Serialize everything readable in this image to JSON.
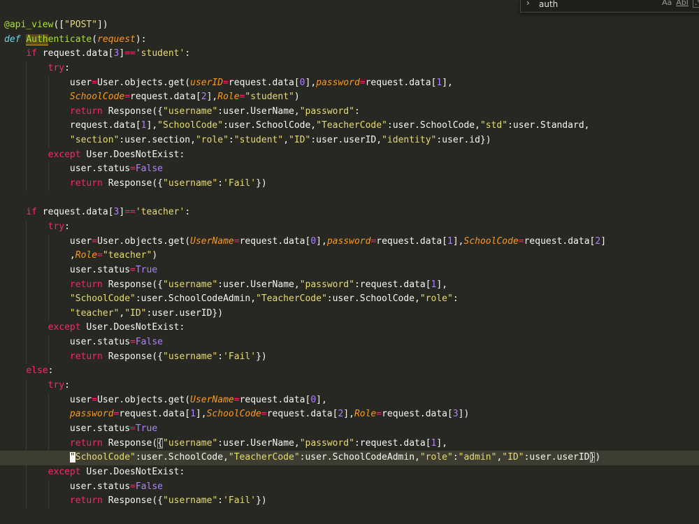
{
  "find_widget": {
    "query": "auth",
    "match_case_label": "Aa",
    "whole_word_label": "Abl",
    "regex_label": ".*",
    "toggle_icon": "chevron-right-icon"
  },
  "colors": {
    "background": "#272822",
    "keyword": "#f92672",
    "function": "#a6e22e",
    "string": "#e6db74",
    "number": "#ae81ff",
    "parameter": "#fd971f",
    "storage": "#66d9ef"
  },
  "code": {
    "lines": [
      {
        "indent": 0,
        "tokens": [
          {
            "t": "deco",
            "v": "@api_view"
          },
          {
            "t": "plain",
            "v": "(["
          },
          {
            "t": "str",
            "v": "\"POST\""
          },
          {
            "t": "plain",
            "v": "])"
          }
        ]
      },
      {
        "indent": 0,
        "tokens": [
          {
            "t": "def",
            "v": "def "
          },
          {
            "t": "fn-hl",
            "v": "Auth"
          },
          {
            "t": "fn",
            "v": "enticate"
          },
          {
            "t": "plain",
            "v": "("
          },
          {
            "t": "param",
            "v": "request"
          },
          {
            "t": "plain",
            "v": "):"
          }
        ]
      },
      {
        "indent": 1,
        "tokens": [
          {
            "t": "kw",
            "v": "if "
          },
          {
            "t": "plain",
            "v": "request.data["
          },
          {
            "t": "num",
            "v": "3"
          },
          {
            "t": "plain",
            "v": "]"
          },
          {
            "t": "op",
            "v": "=="
          },
          {
            "t": "str",
            "v": "'student'"
          },
          {
            "t": "plain",
            "v": ":"
          }
        ]
      },
      {
        "indent": 2,
        "tokens": [
          {
            "t": "kw",
            "v": "try"
          },
          {
            "t": "plain",
            "v": ":"
          }
        ]
      },
      {
        "indent": 3,
        "tokens": [
          {
            "t": "plain",
            "v": "user"
          },
          {
            "t": "op",
            "v": "="
          },
          {
            "t": "plain",
            "v": "User.objects.get("
          },
          {
            "t": "param",
            "v": "userID"
          },
          {
            "t": "op",
            "v": "="
          },
          {
            "t": "plain",
            "v": "request.data["
          },
          {
            "t": "num",
            "v": "0"
          },
          {
            "t": "plain",
            "v": "],"
          },
          {
            "t": "param",
            "v": "password"
          },
          {
            "t": "op",
            "v": "="
          },
          {
            "t": "plain",
            "v": "request.data["
          },
          {
            "t": "num",
            "v": "1"
          },
          {
            "t": "plain",
            "v": "],"
          }
        ]
      },
      {
        "indent": 3,
        "tokens": [
          {
            "t": "param",
            "v": "SchoolCode"
          },
          {
            "t": "op",
            "v": "="
          },
          {
            "t": "plain",
            "v": "request.data["
          },
          {
            "t": "num",
            "v": "2"
          },
          {
            "t": "plain",
            "v": "],"
          },
          {
            "t": "param",
            "v": "Role"
          },
          {
            "t": "op",
            "v": "="
          },
          {
            "t": "str",
            "v": "\"student\""
          },
          {
            "t": "plain",
            "v": ")"
          }
        ]
      },
      {
        "indent": 3,
        "tokens": [
          {
            "t": "kw",
            "v": "return "
          },
          {
            "t": "plain",
            "v": "Response({"
          },
          {
            "t": "str",
            "v": "\"username\""
          },
          {
            "t": "plain",
            "v": ":user.UserName,"
          },
          {
            "t": "str",
            "v": "\"password\""
          },
          {
            "t": "plain",
            "v": ":"
          }
        ]
      },
      {
        "indent": 3,
        "tokens": [
          {
            "t": "plain",
            "v": "request.data["
          },
          {
            "t": "num",
            "v": "1"
          },
          {
            "t": "plain",
            "v": "],"
          },
          {
            "t": "str",
            "v": "\"SchoolCode\""
          },
          {
            "t": "plain",
            "v": ":user.SchoolCode,"
          },
          {
            "t": "str",
            "v": "\"TeacherCode\""
          },
          {
            "t": "plain",
            "v": ":user.SchoolCode,"
          },
          {
            "t": "str",
            "v": "\"std\""
          },
          {
            "t": "plain",
            "v": ":user.Standard,"
          }
        ]
      },
      {
        "indent": 3,
        "tokens": [
          {
            "t": "str",
            "v": "\"section\""
          },
          {
            "t": "plain",
            "v": ":user.section,"
          },
          {
            "t": "str",
            "v": "\"role\""
          },
          {
            "t": "plain",
            "v": ":"
          },
          {
            "t": "str",
            "v": "\"student\""
          },
          {
            "t": "plain",
            "v": ","
          },
          {
            "t": "str",
            "v": "\"ID\""
          },
          {
            "t": "plain",
            "v": ":user.userID,"
          },
          {
            "t": "str",
            "v": "\"identity\""
          },
          {
            "t": "plain",
            "v": ":user.id})"
          }
        ]
      },
      {
        "indent": 2,
        "tokens": [
          {
            "t": "kw",
            "v": "except "
          },
          {
            "t": "plain",
            "v": "User.DoesNotExist:"
          }
        ]
      },
      {
        "indent": 3,
        "tokens": [
          {
            "t": "plain",
            "v": "user.status"
          },
          {
            "t": "op",
            "v": "="
          },
          {
            "t": "const",
            "v": "False"
          }
        ]
      },
      {
        "indent": 3,
        "tokens": [
          {
            "t": "kw",
            "v": "return "
          },
          {
            "t": "plain",
            "v": "Response({"
          },
          {
            "t": "str",
            "v": "\"username\""
          },
          {
            "t": "plain",
            "v": ":"
          },
          {
            "t": "str",
            "v": "'Fail'"
          },
          {
            "t": "plain",
            "v": "})"
          }
        ]
      },
      {
        "indent": 0,
        "tokens": []
      },
      {
        "indent": 1,
        "tokens": [
          {
            "t": "kw",
            "v": "if "
          },
          {
            "t": "plain",
            "v": "request.data["
          },
          {
            "t": "num",
            "v": "3"
          },
          {
            "t": "plain",
            "v": "]"
          },
          {
            "t": "op",
            "v": "=="
          },
          {
            "t": "str",
            "v": "'teacher'"
          },
          {
            "t": "plain",
            "v": ":"
          }
        ]
      },
      {
        "indent": 2,
        "tokens": [
          {
            "t": "kw",
            "v": "try"
          },
          {
            "t": "plain",
            "v": ":"
          }
        ]
      },
      {
        "indent": 3,
        "tokens": [
          {
            "t": "plain",
            "v": "user"
          },
          {
            "t": "op",
            "v": "="
          },
          {
            "t": "plain",
            "v": "User.objects.get("
          },
          {
            "t": "param",
            "v": "UserName"
          },
          {
            "t": "op",
            "v": "="
          },
          {
            "t": "plain",
            "v": "request.data["
          },
          {
            "t": "num",
            "v": "0"
          },
          {
            "t": "plain",
            "v": "],"
          },
          {
            "t": "param",
            "v": "password"
          },
          {
            "t": "op",
            "v": "="
          },
          {
            "t": "plain",
            "v": "request.data["
          },
          {
            "t": "num",
            "v": "1"
          },
          {
            "t": "plain",
            "v": "],"
          },
          {
            "t": "param",
            "v": "SchoolCode"
          },
          {
            "t": "op",
            "v": "="
          },
          {
            "t": "plain",
            "v": "request.data["
          },
          {
            "t": "num",
            "v": "2"
          },
          {
            "t": "plain",
            "v": "]"
          }
        ]
      },
      {
        "indent": 3,
        "tokens": [
          {
            "t": "plain",
            "v": ","
          },
          {
            "t": "param",
            "v": "Role"
          },
          {
            "t": "op",
            "v": "="
          },
          {
            "t": "str",
            "v": "\"teacher\""
          },
          {
            "t": "plain",
            "v": ")"
          }
        ]
      },
      {
        "indent": 3,
        "tokens": [
          {
            "t": "plain",
            "v": "user.status"
          },
          {
            "t": "op",
            "v": "="
          },
          {
            "t": "const",
            "v": "True"
          }
        ]
      },
      {
        "indent": 3,
        "tokens": [
          {
            "t": "kw",
            "v": "return "
          },
          {
            "t": "plain",
            "v": "Response({"
          },
          {
            "t": "str",
            "v": "\"username\""
          },
          {
            "t": "plain",
            "v": ":user.UserName,"
          },
          {
            "t": "str",
            "v": "\"password\""
          },
          {
            "t": "plain",
            "v": ":request.data["
          },
          {
            "t": "num",
            "v": "1"
          },
          {
            "t": "plain",
            "v": "],"
          }
        ]
      },
      {
        "indent": 3,
        "tokens": [
          {
            "t": "str",
            "v": "\"SchoolCode\""
          },
          {
            "t": "plain",
            "v": ":user.SchoolCodeAdmin,"
          },
          {
            "t": "str",
            "v": "\"TeacherCode\""
          },
          {
            "t": "plain",
            "v": ":user.SchoolCode,"
          },
          {
            "t": "str",
            "v": "\"role\""
          },
          {
            "t": "plain",
            "v": ":"
          }
        ]
      },
      {
        "indent": 3,
        "tokens": [
          {
            "t": "str",
            "v": "\"teacher\""
          },
          {
            "t": "plain",
            "v": ","
          },
          {
            "t": "str",
            "v": "\"ID\""
          },
          {
            "t": "plain",
            "v": ":user.userID})"
          }
        ]
      },
      {
        "indent": 2,
        "tokens": [
          {
            "t": "kw",
            "v": "except "
          },
          {
            "t": "plain",
            "v": "User.DoesNotExist:"
          }
        ]
      },
      {
        "indent": 3,
        "tokens": [
          {
            "t": "plain",
            "v": "user.status"
          },
          {
            "t": "op",
            "v": "="
          },
          {
            "t": "const",
            "v": "False"
          }
        ]
      },
      {
        "indent": 3,
        "tokens": [
          {
            "t": "kw",
            "v": "return "
          },
          {
            "t": "plain",
            "v": "Response({"
          },
          {
            "t": "str",
            "v": "\"username\""
          },
          {
            "t": "plain",
            "v": ":"
          },
          {
            "t": "str",
            "v": "'Fail'"
          },
          {
            "t": "plain",
            "v": "})"
          }
        ]
      },
      {
        "indent": 1,
        "tokens": [
          {
            "t": "kw",
            "v": "else"
          },
          {
            "t": "plain",
            "v": ":"
          }
        ]
      },
      {
        "indent": 2,
        "tokens": [
          {
            "t": "kw",
            "v": "try"
          },
          {
            "t": "plain",
            "v": ":"
          }
        ]
      },
      {
        "indent": 3,
        "tokens": [
          {
            "t": "plain",
            "v": "user"
          },
          {
            "t": "op",
            "v": "="
          },
          {
            "t": "plain",
            "v": "User.objects.get("
          },
          {
            "t": "param",
            "v": "UserName"
          },
          {
            "t": "op",
            "v": "="
          },
          {
            "t": "plain",
            "v": "request.data["
          },
          {
            "t": "num",
            "v": "0"
          },
          {
            "t": "plain",
            "v": "],"
          }
        ]
      },
      {
        "indent": 3,
        "tokens": [
          {
            "t": "param",
            "v": "password"
          },
          {
            "t": "op",
            "v": "="
          },
          {
            "t": "plain",
            "v": "request.data["
          },
          {
            "t": "num",
            "v": "1"
          },
          {
            "t": "plain",
            "v": "],"
          },
          {
            "t": "param",
            "v": "SchoolCode"
          },
          {
            "t": "op",
            "v": "="
          },
          {
            "t": "plain",
            "v": "request.data["
          },
          {
            "t": "num",
            "v": "2"
          },
          {
            "t": "plain",
            "v": "],"
          },
          {
            "t": "param",
            "v": "Role"
          },
          {
            "t": "op",
            "v": "="
          },
          {
            "t": "plain",
            "v": "request.data["
          },
          {
            "t": "num",
            "v": "3"
          },
          {
            "t": "plain",
            "v": "])"
          }
        ]
      },
      {
        "indent": 3,
        "tokens": [
          {
            "t": "plain",
            "v": "user.status"
          },
          {
            "t": "op",
            "v": "="
          },
          {
            "t": "const",
            "v": "True"
          }
        ]
      },
      {
        "indent": 3,
        "tokens": [
          {
            "t": "kw",
            "v": "return "
          },
          {
            "t": "plain",
            "v": "Response("
          },
          {
            "t": "bracket",
            "v": "{"
          },
          {
            "t": "str",
            "v": "\"username\""
          },
          {
            "t": "plain",
            "v": ":user.UserName,"
          },
          {
            "t": "str",
            "v": "\"password\""
          },
          {
            "t": "plain",
            "v": ":request.data["
          },
          {
            "t": "num",
            "v": "1"
          },
          {
            "t": "plain",
            "v": "],"
          }
        ]
      },
      {
        "indent": 3,
        "current": true,
        "tokens": [
          {
            "t": "cursor",
            "v": "\""
          },
          {
            "t": "str",
            "v": "SchoolCode\""
          },
          {
            "t": "plain",
            "v": ":user.SchoolCode,"
          },
          {
            "t": "str",
            "v": "\"TeacherCode\""
          },
          {
            "t": "plain",
            "v": ":user.SchoolCodeAdmin,"
          },
          {
            "t": "str",
            "v": "\"role\""
          },
          {
            "t": "plain",
            "v": ":"
          },
          {
            "t": "str",
            "v": "\"admin\""
          },
          {
            "t": "plain",
            "v": ","
          },
          {
            "t": "str",
            "v": "\"ID\""
          },
          {
            "t": "plain",
            "v": ":user.userID"
          },
          {
            "t": "bracket",
            "v": "}"
          },
          {
            "t": "plain",
            "v": ")"
          }
        ]
      },
      {
        "indent": 2,
        "tokens": [
          {
            "t": "kw",
            "v": "except "
          },
          {
            "t": "plain",
            "v": "User.DoesNotExist:"
          }
        ]
      },
      {
        "indent": 3,
        "tokens": [
          {
            "t": "plain",
            "v": "user.status"
          },
          {
            "t": "op",
            "v": "="
          },
          {
            "t": "const",
            "v": "False"
          }
        ]
      },
      {
        "indent": 3,
        "tokens": [
          {
            "t": "kw",
            "v": "return "
          },
          {
            "t": "plain",
            "v": "Response({"
          },
          {
            "t": "str",
            "v": "\"username\""
          },
          {
            "t": "plain",
            "v": ":"
          },
          {
            "t": "str",
            "v": "'Fail'"
          },
          {
            "t": "plain",
            "v": "})"
          }
        ]
      }
    ]
  }
}
